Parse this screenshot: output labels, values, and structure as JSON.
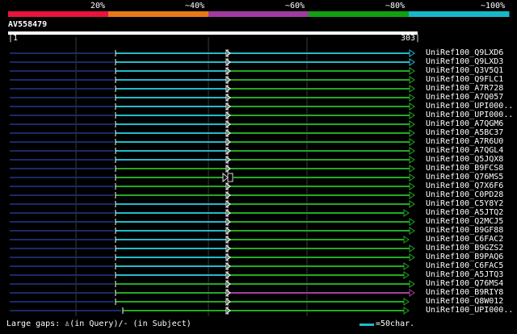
{
  "identity_legend": [
    {
      "label": "20%",
      "color": "#e8143c"
    },
    {
      "label": "~40%",
      "color": "#e87818"
    },
    {
      "label": "~60%",
      "color": "#a03ca0"
    },
    {
      "label": "~80%",
      "color": "#10a010"
    },
    {
      "label": "~100%",
      "color": "#18b8c8"
    }
  ],
  "query": {
    "name": "AV558479",
    "start": "|1",
    "end": "303|"
  },
  "hits": [
    {
      "name": "UniRef100_Q9LXD6",
      "segments": [
        {
          "from": 143,
          "to": 280,
          "color": "#22bbcc"
        },
        {
          "from": 283,
          "to": 507,
          "color": "#22bbcc"
        }
      ],
      "end_mark": "#22bbcc"
    },
    {
      "name": "UniRef100_Q9LXD3",
      "segments": [
        {
          "from": 143,
          "to": 280,
          "color": "#22bbcc"
        },
        {
          "from": 283,
          "to": 507,
          "color": "#22bbcc"
        }
      ],
      "end_mark": "#22bbcc"
    },
    {
      "name": "UniRef100_Q3V5Q1",
      "segments": [
        {
          "from": 143,
          "to": 280,
          "color": "#22bbcc"
        },
        {
          "from": 283,
          "to": 507,
          "color": "#22aa22"
        }
      ],
      "end_mark": "#22aa22"
    },
    {
      "name": "UniRef100_Q9FLC1",
      "segments": [
        {
          "from": 143,
          "to": 280,
          "color": "#22bbcc"
        },
        {
          "from": 283,
          "to": 507,
          "color": "#22aa22"
        }
      ],
      "end_mark": "#22aa22"
    },
    {
      "name": "UniRef100_A7R728",
      "segments": [
        {
          "from": 143,
          "to": 280,
          "color": "#22bbcc"
        },
        {
          "from": 283,
          "to": 507,
          "color": "#22aa22"
        }
      ],
      "end_mark": "#22aa22"
    },
    {
      "name": "UniRef100_A7Q057",
      "segments": [
        {
          "from": 143,
          "to": 280,
          "color": "#22bbcc"
        },
        {
          "from": 283,
          "to": 507,
          "color": "#22aa22"
        }
      ],
      "end_mark": "#22aa22"
    },
    {
      "name": "UniRef100_UPI000..",
      "segments": [
        {
          "from": 143,
          "to": 280,
          "color": "#22bbcc"
        },
        {
          "from": 283,
          "to": 507,
          "color": "#22aa22"
        }
      ],
      "end_mark": "#22aa22"
    },
    {
      "name": "UniRef100_UPI000..",
      "segments": [
        {
          "from": 143,
          "to": 280,
          "color": "#22bbcc"
        },
        {
          "from": 283,
          "to": 507,
          "color": "#22aa22"
        }
      ],
      "end_mark": "#22aa22"
    },
    {
      "name": "UniRef100_A7QGM6",
      "segments": [
        {
          "from": 143,
          "to": 280,
          "color": "#22bbcc"
        },
        {
          "from": 283,
          "to": 507,
          "color": "#22aa22"
        }
      ],
      "end_mark": "#22aa22"
    },
    {
      "name": "UniRef100_A5BC37",
      "segments": [
        {
          "from": 143,
          "to": 280,
          "color": "#22bbcc"
        },
        {
          "from": 283,
          "to": 507,
          "color": "#22aa22"
        }
      ],
      "end_mark": "#22aa22"
    },
    {
      "name": "UniRef100_A7R6U0",
      "segments": [
        {
          "from": 143,
          "to": 280,
          "color": "#22bbcc"
        },
        {
          "from": 283,
          "to": 507,
          "color": "#22aa22"
        }
      ],
      "end_mark": "#22aa22"
    },
    {
      "name": "UniRef100_A7QGL4",
      "segments": [
        {
          "from": 143,
          "to": 280,
          "color": "#22bbcc"
        },
        {
          "from": 283,
          "to": 507,
          "color": "#22aa22"
        }
      ],
      "end_mark": "#22aa22"
    },
    {
      "name": "UniRef100_Q5JQX8",
      "segments": [
        {
          "from": 143,
          "to": 280,
          "color": "#22bbcc"
        },
        {
          "from": 283,
          "to": 507,
          "color": "#22aa22"
        }
      ],
      "end_mark": "#22aa22"
    },
    {
      "name": "UniRef100_B9FCS8",
      "segments": [
        {
          "from": 143,
          "to": 280,
          "color": "#22aa22"
        },
        {
          "from": 283,
          "to": 507,
          "color": "#22aa22"
        }
      ],
      "end_mark": "#22aa22"
    },
    {
      "name": "UniRef100_Q76MS5",
      "segments": [
        {
          "from": 143,
          "to": 276,
          "color": "#22aa22"
        },
        {
          "from": 289,
          "to": 507,
          "color": "#22aa22"
        }
      ],
      "end_mark": "#22aa22",
      "gap_mark": true
    },
    {
      "name": "UniRef100_Q7X6F6",
      "segments": [
        {
          "from": 143,
          "to": 280,
          "color": "#22aa22"
        },
        {
          "from": 283,
          "to": 507,
          "color": "#22aa22"
        }
      ],
      "end_mark": "#22aa22"
    },
    {
      "name": "UniRef100_C0PD28",
      "segments": [
        {
          "from": 143,
          "to": 280,
          "color": "#22aa22"
        },
        {
          "from": 283,
          "to": 507,
          "color": "#22aa22"
        }
      ],
      "end_mark": "#22aa22"
    },
    {
      "name": "UniRef100_C5Y8Y2",
      "segments": [
        {
          "from": 143,
          "to": 280,
          "color": "#22bbcc"
        },
        {
          "from": 283,
          "to": 507,
          "color": "#22aa22"
        }
      ],
      "end_mark": "#22aa22"
    },
    {
      "name": "UniRef100_A5JTQ2",
      "segments": [
        {
          "from": 143,
          "to": 280,
          "color": "#22bbcc"
        },
        {
          "from": 283,
          "to": 500,
          "color": "#22aa22"
        }
      ],
      "end_mark": "#22aa22"
    },
    {
      "name": "UniRef100_Q2MCJ5",
      "segments": [
        {
          "from": 143,
          "to": 280,
          "color": "#22bbcc"
        },
        {
          "from": 283,
          "to": 507,
          "color": "#22aa22"
        }
      ],
      "end_mark": "#22aa22"
    },
    {
      "name": "UniRef100_B9GF88",
      "segments": [
        {
          "from": 143,
          "to": 280,
          "color": "#22bbcc"
        },
        {
          "from": 283,
          "to": 507,
          "color": "#22aa22"
        }
      ],
      "end_mark": "#22aa22"
    },
    {
      "name": "UniRef100_C6FAC2",
      "segments": [
        {
          "from": 143,
          "to": 280,
          "color": "#22bbcc"
        },
        {
          "from": 283,
          "to": 500,
          "color": "#22aa22"
        }
      ],
      "end_mark": "#22aa22"
    },
    {
      "name": "UniRef100_B9GZS2",
      "segments": [
        {
          "from": 143,
          "to": 280,
          "color": "#22bbcc"
        },
        {
          "from": 283,
          "to": 507,
          "color": "#22aa22"
        }
      ],
      "end_mark": "#22aa22"
    },
    {
      "name": "UniRef100_B9PAQ6",
      "segments": [
        {
          "from": 143,
          "to": 280,
          "color": "#22bbcc"
        },
        {
          "from": 283,
          "to": 507,
          "color": "#22aa22"
        }
      ],
      "end_mark": "#22aa22"
    },
    {
      "name": "UniRef100_C6FAC5",
      "segments": [
        {
          "from": 143,
          "to": 280,
          "color": "#22bbcc"
        },
        {
          "from": 283,
          "to": 500,
          "color": "#22aa22"
        }
      ],
      "end_mark": "#22aa22"
    },
    {
      "name": "UniRef100_A5JTQ3",
      "segments": [
        {
          "from": 143,
          "to": 280,
          "color": "#22bbcc"
        },
        {
          "from": 283,
          "to": 500,
          "color": "#22aa22"
        }
      ],
      "end_mark": "#22aa22"
    },
    {
      "name": "UniRef100_Q76MS4",
      "segments": [
        {
          "from": 143,
          "to": 280,
          "color": "#22aa22"
        },
        {
          "from": 283,
          "to": 507,
          "color": "#22aa22"
        }
      ],
      "end_mark": "#22aa22"
    },
    {
      "name": "UniRef100_B9RIY8",
      "segments": [
        {
          "from": 143,
          "to": 280,
          "color": "#22aa22"
        },
        {
          "from": 283,
          "to": 507,
          "color": "#a040a0"
        }
      ],
      "end_mark": "#a040a0"
    },
    {
      "name": "UniRef100_Q8W012",
      "segments": [
        {
          "from": 143,
          "to": 280,
          "color": "#22aa22"
        },
        {
          "from": 283,
          "to": 500,
          "color": "#22aa22"
        }
      ],
      "end_mark": "#22aa22"
    },
    {
      "name": "UniRef100_UPI000..",
      "segments": [
        {
          "from": 152,
          "to": 280,
          "color": "#22aa22"
        },
        {
          "from": 283,
          "to": 500,
          "color": "#22aa22"
        }
      ],
      "end_mark": "#22aa22",
      "start_bar": true
    }
  ],
  "footer": {
    "gaps_legend": "Large gaps: ♙(in Query)/- (in Subject)",
    "scale_label": "=50char."
  }
}
